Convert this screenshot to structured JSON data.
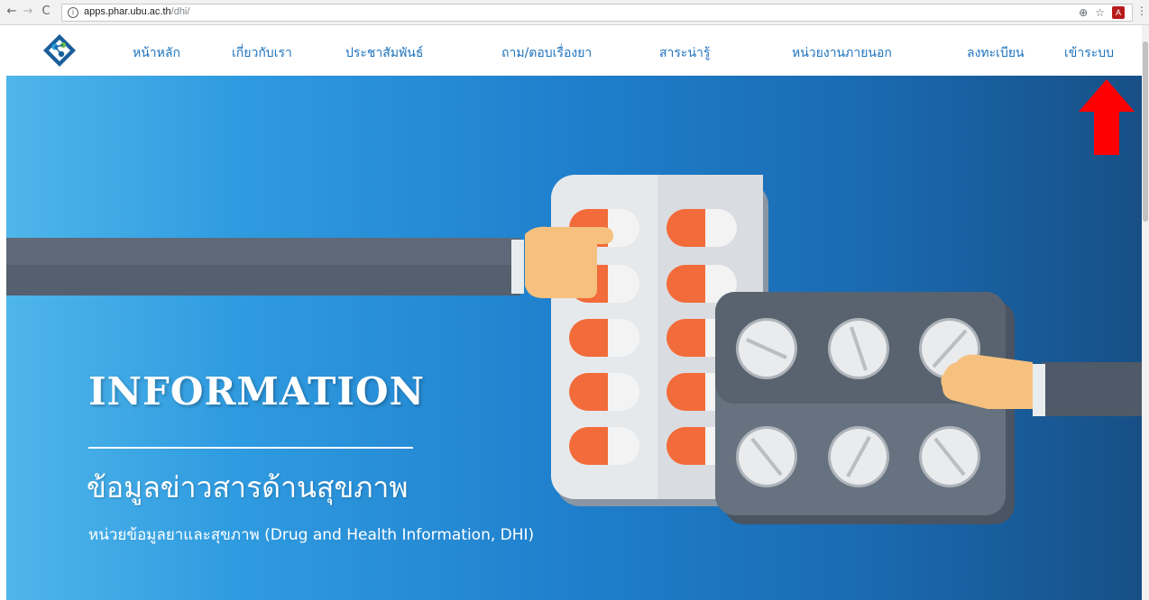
{
  "browser": {
    "url_host": "apps.phar.ubu.ac.th",
    "url_path": "/dhi/",
    "back_icon": "←",
    "forward_icon": "→",
    "reload_icon": "C",
    "info_icon": "i",
    "zoom_icon": "⊕",
    "star_icon": "☆",
    "menu_icon": "⋮"
  },
  "nav": {
    "items": [
      {
        "label": "หน้าหลัก"
      },
      {
        "label": "เกี่ยวกับเรา"
      },
      {
        "label": "ประชาสัมพันธ์"
      },
      {
        "label": "ถาม/ตอบเรื่องยา"
      },
      {
        "label": "สาระน่ารู้"
      },
      {
        "label": "หน่วยงานภายนอก"
      },
      {
        "label": "ลงทะเบียน"
      },
      {
        "label": "เข้าระบบ"
      }
    ]
  },
  "hero": {
    "title": "INFORMATION",
    "subtitle": "ข้อมูลข่าวสารด้านสุขภาพ",
    "caption": "หน่วยข้อมูลยาและสุขภาพ (Drug and Health Information, DHI)"
  },
  "colors": {
    "nav_text": "#1e73be",
    "hero_start": "#4fb6ea",
    "hero_end": "#174f86",
    "annotation": "#ff0000"
  }
}
